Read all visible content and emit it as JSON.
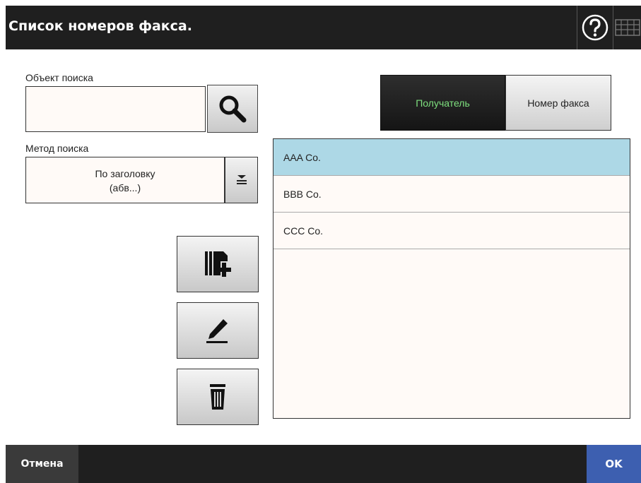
{
  "header": {
    "title": "Список номеров факса.",
    "help_icon": "help-icon",
    "keyboard_icon": "keyboard-icon"
  },
  "search": {
    "label": "Объект поиска",
    "value": "",
    "button_icon": "search-icon"
  },
  "method": {
    "label": "Метод поиска",
    "selected_line1": "По заголовку",
    "selected_line2": "(абв...)",
    "dropdown_icon": "dropdown-icon"
  },
  "actions": {
    "add_icon": "add-entry-icon",
    "edit_icon": "edit-icon",
    "delete_icon": "trash-icon"
  },
  "tabs": [
    {
      "label": "Получатель",
      "active": true
    },
    {
      "label": "Номер факса",
      "active": false
    }
  ],
  "list": {
    "items": [
      {
        "label": "AAA Co.",
        "selected": true
      },
      {
        "label": "BBB Co.",
        "selected": false
      },
      {
        "label": "CCC Co.",
        "selected": false
      }
    ]
  },
  "footer": {
    "cancel_label": "Отмена",
    "ok_label": "OK"
  },
  "colors": {
    "bar": "#1f1f1f",
    "selected_row": "#add8e6",
    "active_tab_text": "#7ee07e",
    "ok_button": "#3d5fb0"
  }
}
